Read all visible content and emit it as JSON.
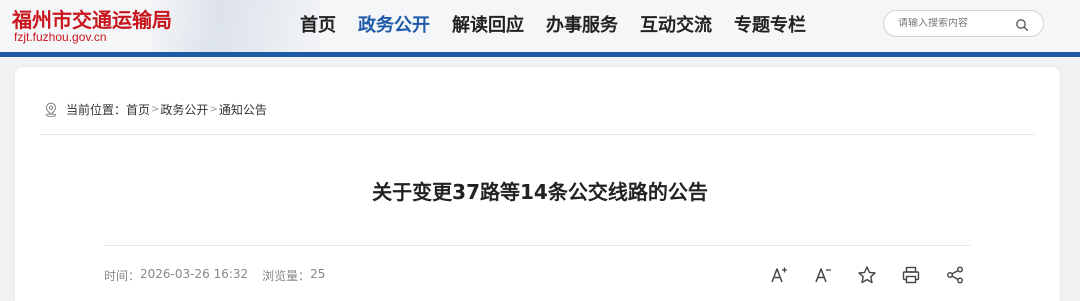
{
  "site": {
    "title": "福州市交通运输局",
    "domain": "fzjt.fuzhou.gov.cn"
  },
  "nav": {
    "items": [
      {
        "label": "首页",
        "active": false
      },
      {
        "label": "政务公开",
        "active": true
      },
      {
        "label": "解读回应",
        "active": false
      },
      {
        "label": "办事服务",
        "active": false
      },
      {
        "label": "互动交流",
        "active": false
      },
      {
        "label": "专题专栏",
        "active": false
      }
    ]
  },
  "search": {
    "placeholder": "请输入搜索内容",
    "value": ""
  },
  "breadcrumb": {
    "prefix": "当前位置：",
    "items": [
      "首页",
      "政务公开",
      "通知公告"
    ],
    "separator": ">"
  },
  "article": {
    "title": "关于变更37路等14条公交线路的公告",
    "time_label": "时间：",
    "time": "2026-03-26 16:32",
    "views_label": "浏览量：",
    "views": "25"
  },
  "tools": [
    "font-increase-icon",
    "font-decrease-icon",
    "star-icon",
    "print-icon",
    "share-icon"
  ],
  "colors": {
    "brand_red": "#c8161e",
    "accent_blue": "#1f5ba5",
    "active_nav": "#1d5aa8"
  }
}
